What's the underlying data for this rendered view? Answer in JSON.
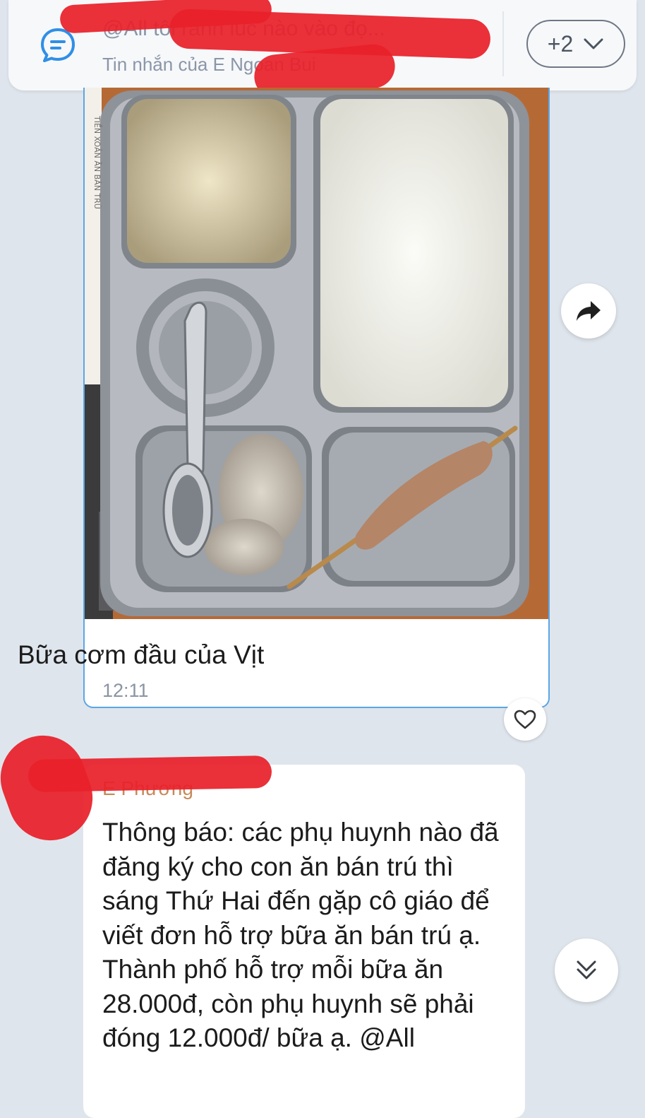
{
  "pinned": {
    "message": "@All tôi rảnh lúc nào vào đọ...",
    "source": "Tin nhắn của E Ngoan Bui",
    "more_count": "+2"
  },
  "messages": [
    {
      "type": "photo",
      "caption": "Bữa cơm đầu của Vịt",
      "time": "12:11",
      "photo_description_icon": "meal-tray-photo"
    },
    {
      "type": "text",
      "sender": "E Phương",
      "text": "Thông báo: các phụ huynh nào đã đăng ký cho con ăn bán trú thì sáng Thứ Hai đến gặp cô giáo để viết đơn hỗ trợ bữa ăn bán trú ạ. Thành phố hỗ trợ mỗi bữa ăn 28.000đ, còn phụ huynh sẽ phải đóng 12.000đ/ bữa ạ. @All"
    }
  ],
  "colors": {
    "background": "#dfe5ec",
    "accent": "#3b8fe0",
    "redaction": "#e8202a"
  },
  "icons": [
    "chat-bubble-icon",
    "chevron-down-icon",
    "share-arrow-icon",
    "heart-icon",
    "double-chevron-down-icon"
  ]
}
